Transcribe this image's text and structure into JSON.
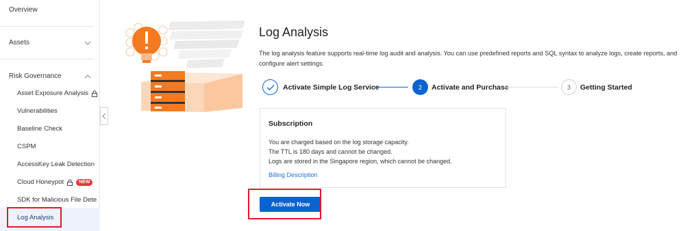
{
  "sidebar": {
    "overview": "Overview",
    "assets": "Assets",
    "risk_governance": "Risk Governance",
    "items": [
      {
        "label": "Asset Exposure Analysis",
        "locked": true
      },
      {
        "label": "Vulnerabilities"
      },
      {
        "label": "Baseline Check"
      },
      {
        "label": "CSPM"
      },
      {
        "label": "AccessKey Leak Detection"
      },
      {
        "label": "Cloud Honeypot",
        "locked": true,
        "badge": "NEW"
      },
      {
        "label": "SDK for Malicious File Dete"
      },
      {
        "label": "Log Analysis",
        "active": true
      }
    ]
  },
  "main": {
    "title": "Log Analysis",
    "description": "The log analysis feature supports real-time log audit and analysis. You can use predefined reports and SQL syntax to analyze logs, create reports, and configure alert settings.",
    "steps": [
      {
        "number": "",
        "label": "Activate Simple Log Service",
        "status": "done"
      },
      {
        "number": "2",
        "label": "Activate and Purchase",
        "status": "active"
      },
      {
        "number": "3",
        "label": "Getting Started",
        "status": "pending"
      }
    ],
    "subscription": {
      "title": "Subscription",
      "lines": [
        "You are charged based on the log storage capacity.",
        "The TTL is 180 days and cannot be changed.",
        "Logs are stored in the Singapore region, which cannot be changed."
      ],
      "link": "Billing Description"
    },
    "activate_button": "Activate Now"
  },
  "colors": {
    "primary": "#0b63d1",
    "highlight": "#e5162a",
    "illustration_orange": "#f47a22"
  }
}
